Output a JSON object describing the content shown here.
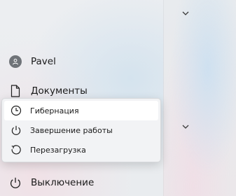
{
  "user": {
    "name": "Pavel",
    "icon": "person-icon"
  },
  "nav": {
    "documents": {
      "label": "Документы",
      "icon": "document-icon"
    },
    "power": {
      "label": "Выключение",
      "icon": "power-icon"
    }
  },
  "power_menu": {
    "items": [
      {
        "label": "Гибернация",
        "icon": "clock-icon",
        "highlighted": true
      },
      {
        "label": "Завершение работы",
        "icon": "power-icon",
        "highlighted": false
      },
      {
        "label": "Перезагрузка",
        "icon": "restart-icon",
        "highlighted": false
      }
    ]
  },
  "colors": {
    "popup_background": "#f2f3f5",
    "highlight": "#ffffff",
    "text": "#1a1a1a",
    "avatar": "#6f7378"
  }
}
